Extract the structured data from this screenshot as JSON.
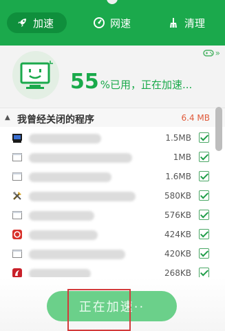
{
  "tabs": [
    {
      "label": "加速",
      "icon": "rocket-icon",
      "active": true
    },
    {
      "label": "网速",
      "icon": "speedometer-icon",
      "active": false
    },
    {
      "label": "清理",
      "icon": "broom-icon",
      "active": false
    }
  ],
  "status": {
    "percent": "55",
    "suffix": "%已用，正在加速..."
  },
  "list": {
    "title": "我曾经关闭的程序",
    "total_size": "6.4 MB",
    "items": [
      {
        "size": "1.5MB",
        "icon": "terminal-icon"
      },
      {
        "size": "1MB",
        "icon": "window-icon"
      },
      {
        "size": "1.6MB",
        "icon": "window-icon"
      },
      {
        "size": "580KB",
        "icon": "tools-icon"
      },
      {
        "size": "576KB",
        "icon": "window-icon"
      },
      {
        "size": "424KB",
        "icon": "red-app-icon"
      },
      {
        "size": "420KB",
        "icon": "window-icon"
      },
      {
        "size": "268KB",
        "icon": "red-app-icon"
      }
    ]
  },
  "action_button": {
    "label": "正在加速··"
  },
  "colors": {
    "brand_green": "#1ba94c",
    "accent_red": "#e05a3a"
  }
}
